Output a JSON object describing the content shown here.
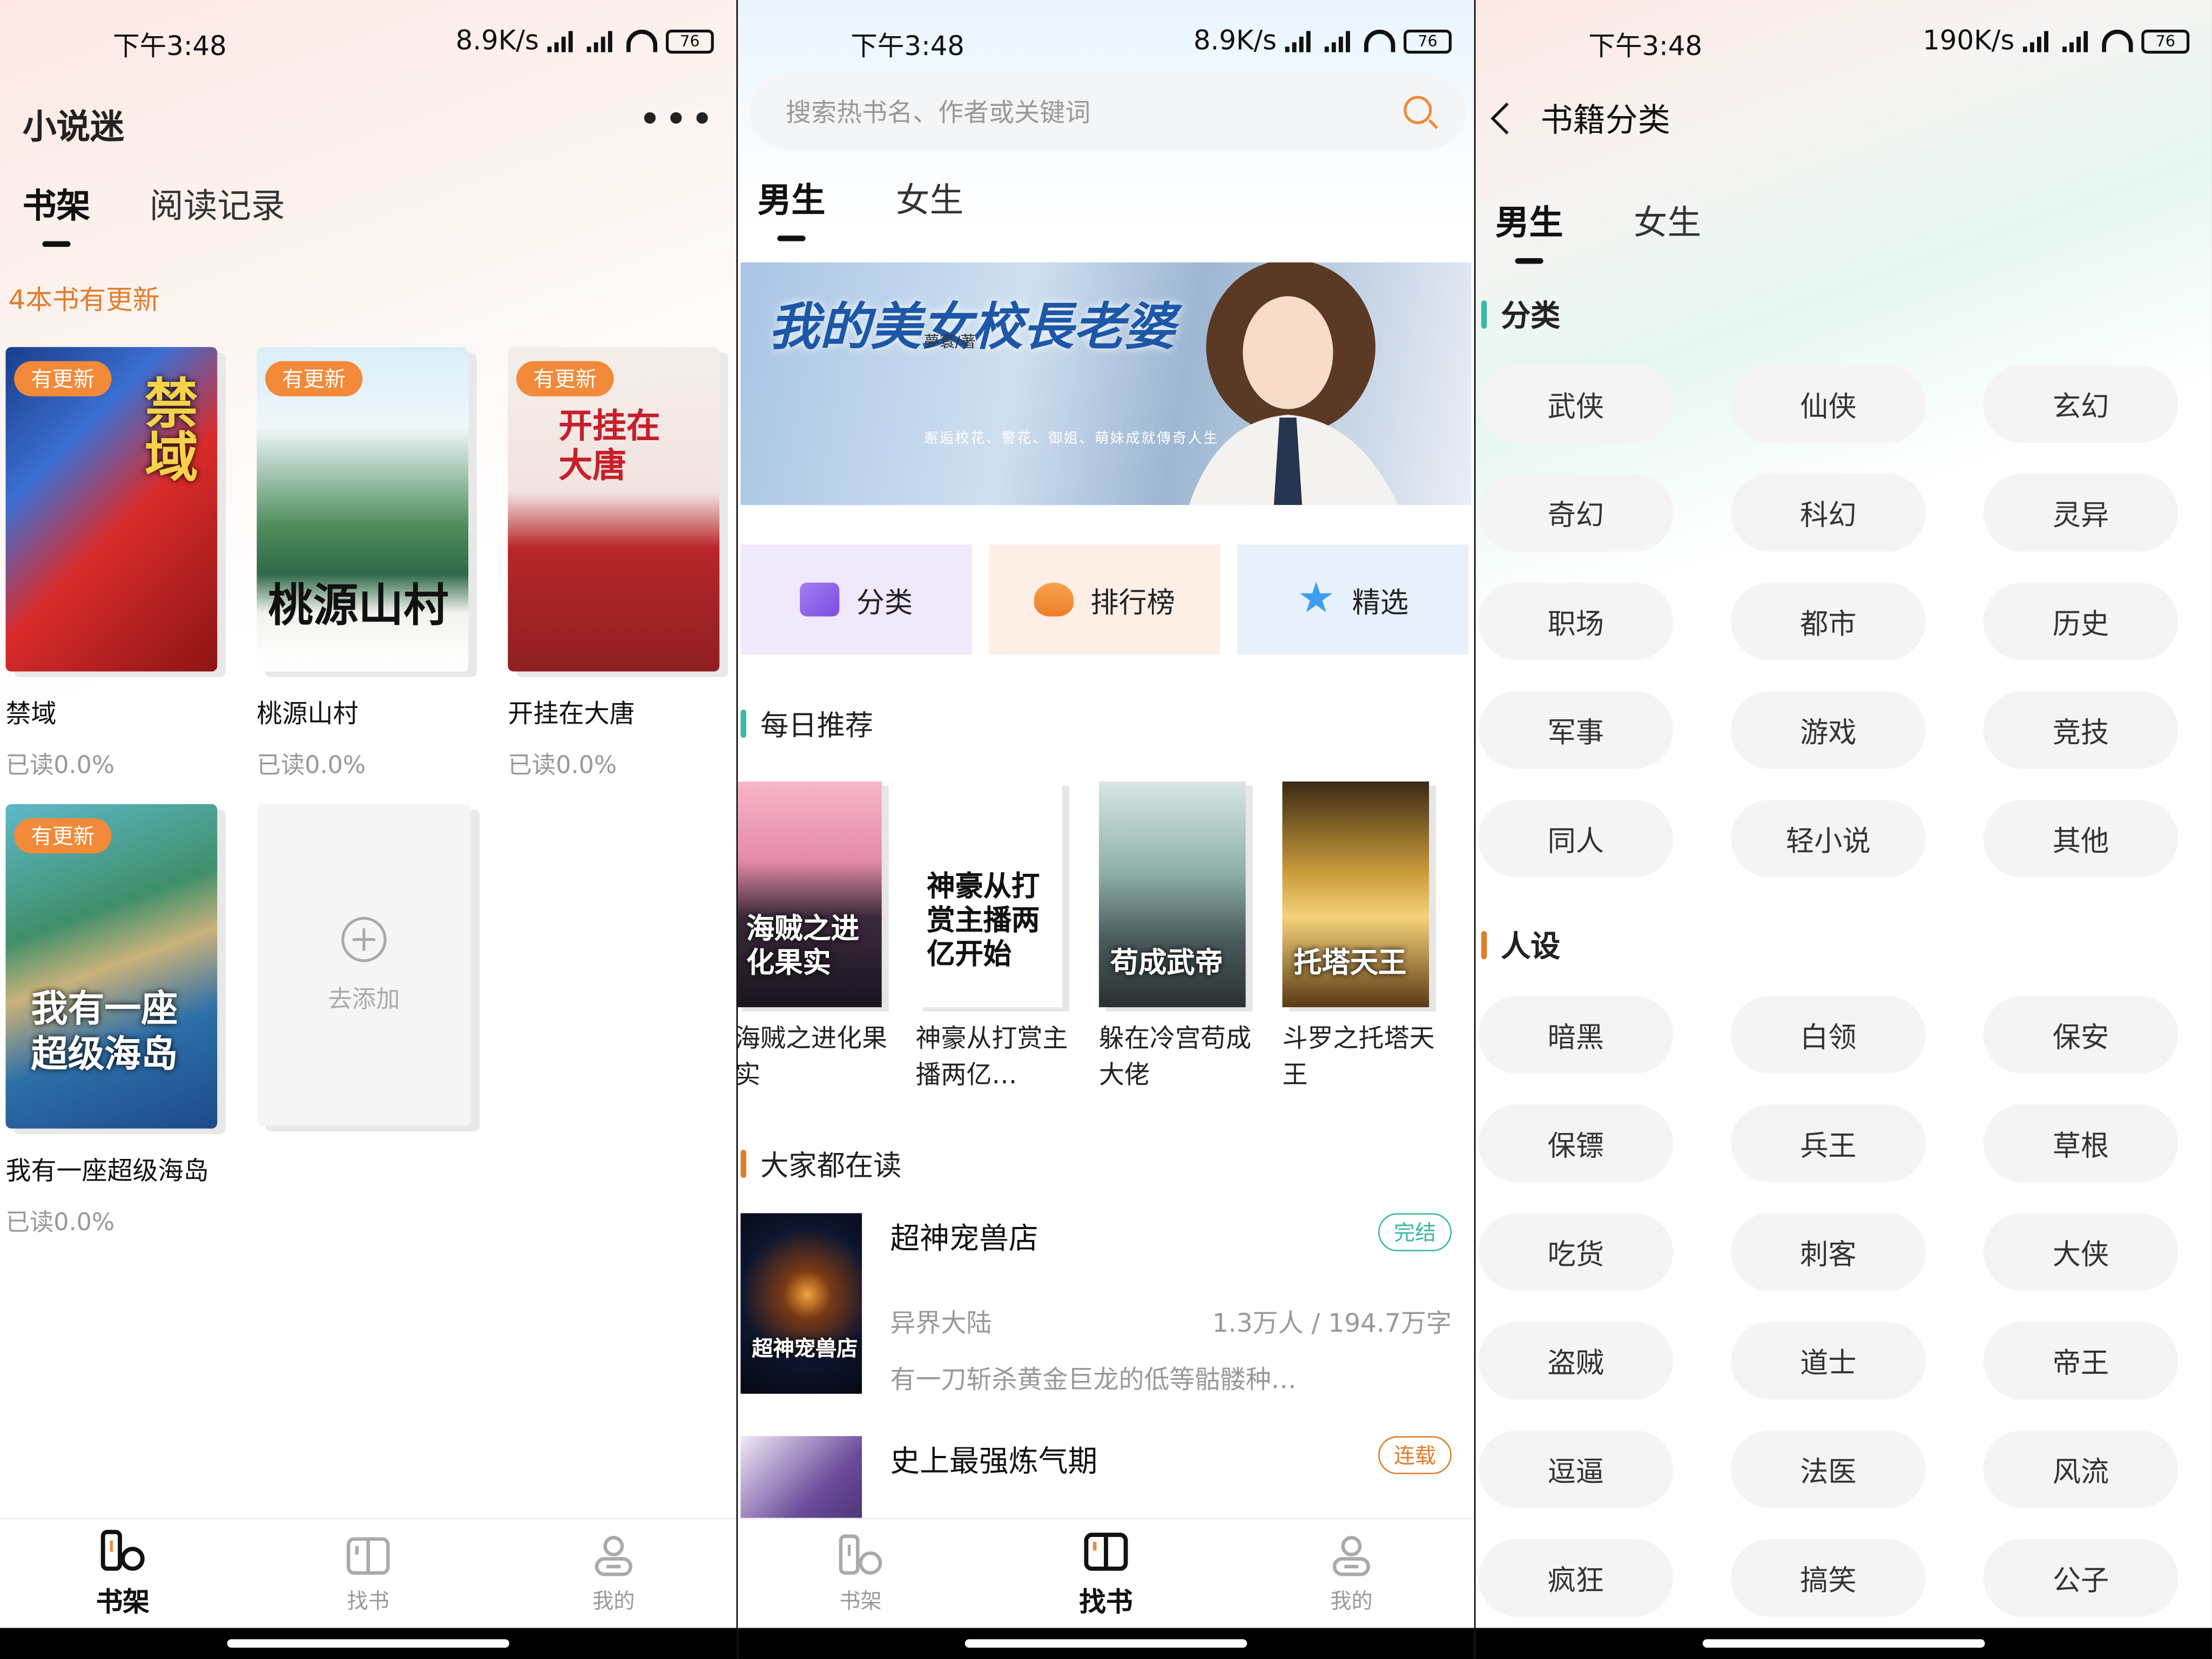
{
  "status_bar": {
    "time": "下午3:48",
    "speed_1": "8.9K/s",
    "speed_2": "8.9K/s",
    "speed_3": "190K/s",
    "battery": "76"
  },
  "shelf": {
    "app_title": "小说迷",
    "tabs": [
      "书架",
      "阅读记录"
    ],
    "update_note": "4本书有更新",
    "badge_label": "有更新",
    "books": [
      {
        "name": "禁域",
        "progress": "已读0.0%",
        "cover_text": "禁域"
      },
      {
        "name": "桃源山村",
        "progress": "已读0.0%",
        "cover_text": "桃源山村"
      },
      {
        "name": "开挂在大唐",
        "progress": "已读0.0%",
        "cover_text": "开挂在大唐"
      },
      {
        "name": "我有一座超级海岛",
        "progress": "已读0.0%",
        "cover_text": "我有一座超级海岛"
      }
    ],
    "add_label": "去添加"
  },
  "find": {
    "search_placeholder": "搜索热书名、作者或关键词",
    "gender_tabs": [
      "男生",
      "女生"
    ],
    "banner": {
      "title": "我的美女校長老婆",
      "author": "夢寰/著",
      "tagline": "邂逅校花、警花、御姐、萌妹成就傳奇人生"
    },
    "quick": [
      "分类",
      "排行榜",
      "精选"
    ],
    "daily_title": "每日推荐",
    "daily": [
      {
        "name": "海贼之进化果实",
        "cover_text": "海贼之进化果实"
      },
      {
        "name": "神豪从打赏主播两亿…",
        "cover_text": "神豪从打赏主播两亿开始"
      },
      {
        "name": "躲在冷宫苟成大佬",
        "cover_text": "苟成武帝"
      },
      {
        "name": "斗罗之托塔天王",
        "cover_text": "托塔天王"
      }
    ],
    "popular_title": "大家都在读",
    "popular": [
      {
        "title": "超神宠兽店",
        "status": "完结",
        "genre": "异界大陆",
        "stats": "1.3万人 / 194.7万字",
        "desc": "有一刀斩杀黄金巨龙的低等骷髅种…",
        "cover_text": "超神宠兽店"
      },
      {
        "title": "史上最强炼气期",
        "status": "连载"
      }
    ]
  },
  "category": {
    "title": "书籍分类",
    "gender_tabs": [
      "男生",
      "女生"
    ],
    "section1": "分类",
    "chips1": [
      "武侠",
      "仙侠",
      "玄幻",
      "奇幻",
      "科幻",
      "灵异",
      "职场",
      "都市",
      "历史",
      "军事",
      "游戏",
      "竞技",
      "同人",
      "轻小说",
      "其他"
    ],
    "section2": "人设",
    "chips2": [
      "暗黑",
      "白领",
      "保安",
      "保镖",
      "兵王",
      "草根",
      "吃货",
      "刺客",
      "大侠",
      "盗贼",
      "道士",
      "帝王",
      "逗逼",
      "法医",
      "风流",
      "疯狂",
      "搞笑",
      "公子"
    ]
  },
  "tabbar": {
    "shelf": "书架",
    "find": "找书",
    "mine": "我的"
  },
  "colors": {
    "accent": "#f08a3a",
    "badge": "#f28a3a",
    "complete": "#3bb8a2",
    "ongoing": "#e07d2b"
  }
}
